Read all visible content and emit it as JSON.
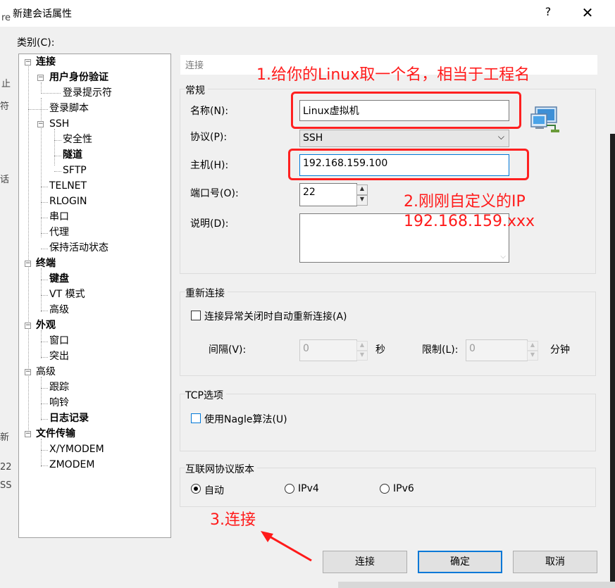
{
  "window": {
    "title": "新建会话属性",
    "help": "?",
    "close": "✕"
  },
  "edge": {
    "l1": "re",
    "l2": "止",
    "l3": "符",
    "l4": "话",
    "l5": "新",
    "l6": "22",
    "l7": "SS"
  },
  "category_label": "类别(C):",
  "tree": [
    {
      "label": "连接",
      "bold": true
    },
    {
      "label": "用户身份验证",
      "bold": true
    },
    {
      "label": "登录提示符",
      "bold": false
    },
    {
      "label": "登录脚本",
      "bold": false
    },
    {
      "label": "SSH",
      "bold": false
    },
    {
      "label": "安全性",
      "bold": false
    },
    {
      "label": "隧道",
      "bold": true
    },
    {
      "label": "SFTP",
      "bold": false
    },
    {
      "label": "TELNET",
      "bold": false
    },
    {
      "label": "RLOGIN",
      "bold": false
    },
    {
      "label": "串口",
      "bold": false
    },
    {
      "label": "代理",
      "bold": false
    },
    {
      "label": "保持活动状态",
      "bold": false
    },
    {
      "label": "终端",
      "bold": true
    },
    {
      "label": "键盘",
      "bold": true
    },
    {
      "label": "VT 模式",
      "bold": false
    },
    {
      "label": "高级",
      "bold": false
    },
    {
      "label": "外观",
      "bold": true
    },
    {
      "label": "窗口",
      "bold": false
    },
    {
      "label": "突出",
      "bold": false
    },
    {
      "label": "高级",
      "bold": false
    },
    {
      "label": "跟踪",
      "bold": false
    },
    {
      "label": "响铃",
      "bold": false
    },
    {
      "label": "日志记录",
      "bold": true
    },
    {
      "label": "文件传输",
      "bold": true
    },
    {
      "label": "X/YMODEM",
      "bold": false
    },
    {
      "label": "ZMODEM",
      "bold": false
    }
  ],
  "header": "连接",
  "general": {
    "group": "常规",
    "name_label": "名称(N):",
    "name_value": "Linux虚拟机",
    "protocol_label": "协议(P):",
    "protocol_value": "SSH",
    "host_label": "主机(H):",
    "host_value": "192.168.159.100",
    "port_label": "端口号(O):",
    "port_value": "22",
    "desc_label": "说明(D):"
  },
  "reconnect": {
    "group": "重新连接",
    "checkbox_label": "连接异常关闭时自动重新连接(A)",
    "interval_label": "间隔(V):",
    "interval_value": "0",
    "sec": "秒",
    "limit_label": "限制(L):",
    "limit_value": "0",
    "min": "分钟"
  },
  "tcp": {
    "group": "TCP选项",
    "nagle_label": "使用Nagle算法(U)"
  },
  "ipver": {
    "group": "互联网协议版本",
    "auto": "自动",
    "ipv4": "IPv4",
    "ipv6": "IPv6"
  },
  "buttons": {
    "connect": "连接",
    "ok": "确定",
    "cancel": "取消"
  },
  "annotations": {
    "a1": "1.给你的Linux取一个名，相当于工程名",
    "a2_line1": "2.刚刚自定义的IP",
    "a2_line2": "192.168.159.xxx",
    "a3": "3.连接"
  },
  "colors": {
    "annotation": "#ff1a1a",
    "focus": "#0078d7"
  }
}
